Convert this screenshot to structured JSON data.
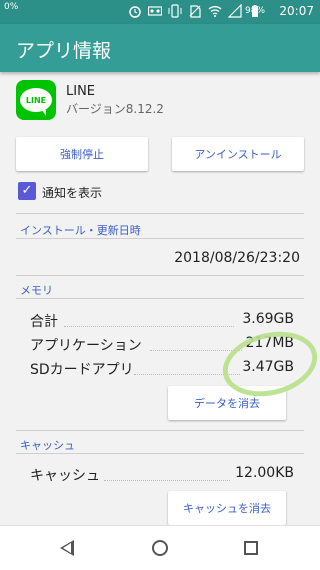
{
  "status_bar": {
    "left_text": "0%",
    "battery": "98%",
    "time": "20:07"
  },
  "app_bar": {
    "title": "アプリ情報"
  },
  "app": {
    "name": "LINE",
    "version": "バージョン8.12.2",
    "icon_text": "LINE"
  },
  "buttons": {
    "force_stop": "強制停止",
    "uninstall": "アンインストール",
    "clear_data": "データを消去",
    "clear_cache": "キャッシュを消去"
  },
  "notification": {
    "label": "通知を表示",
    "checked": true
  },
  "install_section": {
    "header": "インストール・更新日時",
    "date": "2018/08/26/23:20"
  },
  "memory_section": {
    "header": "メモリ",
    "rows": [
      {
        "label": "合計",
        "value": "3.69GB"
      },
      {
        "label": "アプリケーション",
        "value": "217MB"
      },
      {
        "label": "SDカードアプリ",
        "value": "3.47GB"
      }
    ]
  },
  "cache_section": {
    "header": "キャッシュ",
    "rows": [
      {
        "label": "キャッシュ",
        "value": "12.00KB"
      }
    ]
  },
  "colors": {
    "status_bar": "#2c8f88",
    "app_bar": "#349d95",
    "accent": "#3b5fc9",
    "checkbox": "#5a5ad6",
    "line_green": "#00c300",
    "highlight_circle": "#b7e08a"
  }
}
